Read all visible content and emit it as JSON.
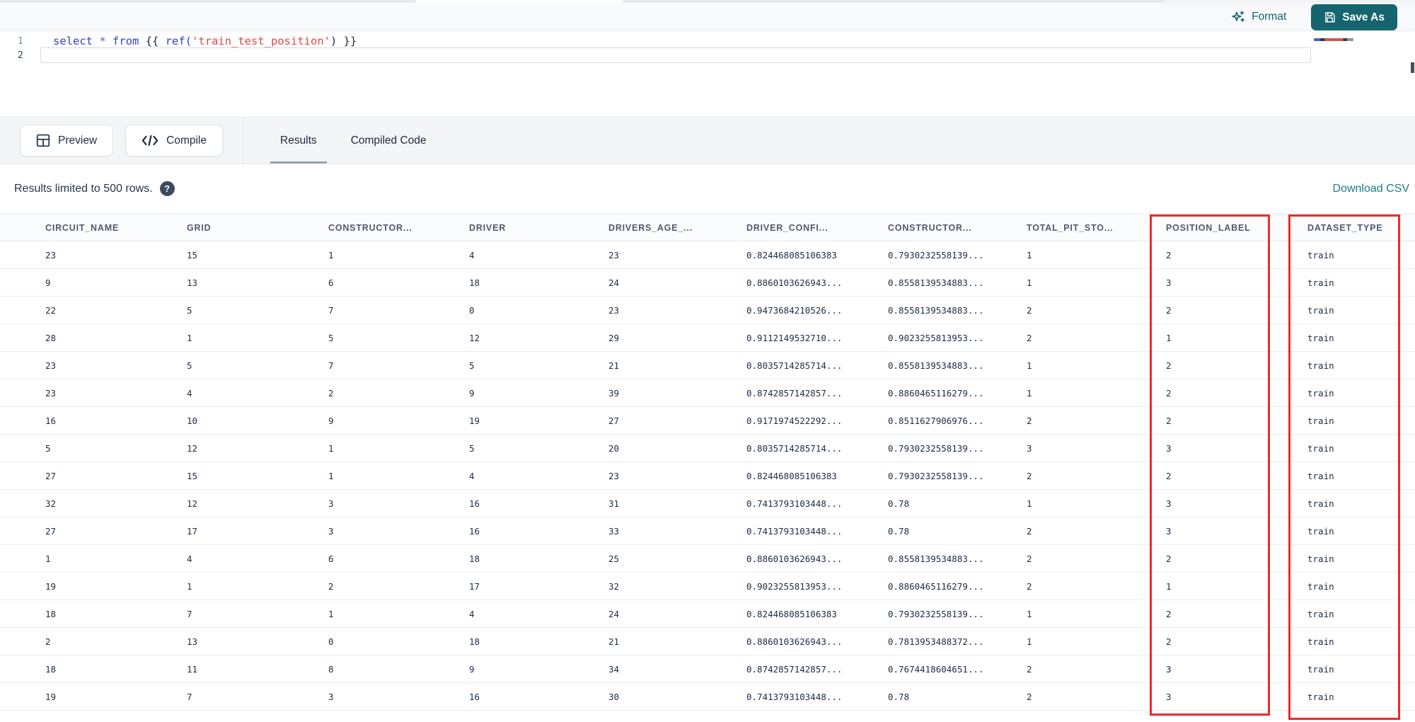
{
  "colors": {
    "accent_teal": "#14656E",
    "link_teal": "#1B7D89",
    "annotation_red": "#F1282C"
  },
  "editor_toolbar": {
    "format_label": "Format",
    "save_as_label": "Save As"
  },
  "editor": {
    "line_numbers": [
      "1",
      "2"
    ],
    "code_tokens": [
      {
        "t": "select",
        "c": "kw"
      },
      {
        "t": " ",
        "c": "pl"
      },
      {
        "t": "*",
        "c": "op"
      },
      {
        "t": " ",
        "c": "pl"
      },
      {
        "t": "from",
        "c": "kw"
      },
      {
        "t": " ",
        "c": "pl"
      },
      {
        "t": "{{ ",
        "c": "br"
      },
      {
        "t": "ref(",
        "c": "fn"
      },
      {
        "t": "'train_test_position'",
        "c": "str"
      },
      {
        "t": ")",
        "c": "br"
      },
      {
        "t": " }}",
        "c": "br"
      }
    ]
  },
  "action_bar": {
    "preview_label": "Preview",
    "compile_label": "Compile",
    "tabs": [
      {
        "label": "Results",
        "active": true
      },
      {
        "label": "Compiled Code",
        "active": false
      }
    ]
  },
  "results_bar": {
    "limit_text": "Results limited to 500 rows.",
    "help_glyph": "?",
    "download_label": "Download CSV"
  },
  "table": {
    "columns": [
      "CIRCUIT_NAME",
      "GRID",
      "CONSTRUCTOR...",
      "DRIVER",
      "DRIVERS_AGE_...",
      "DRIVER_CONFI...",
      "CONSTRUCTOR...",
      "TOTAL_PIT_STO...",
      "POSITION_LABEL",
      "DATASET_TYPE"
    ],
    "highlighted_columns": [
      "POSITION_LABEL",
      "DATASET_TYPE"
    ],
    "rows": [
      [
        "23",
        "15",
        "1",
        "4",
        "23",
        "0.824468085106383",
        "0.7930232558139...",
        "1",
        "2",
        "train"
      ],
      [
        "9",
        "13",
        "6",
        "18",
        "24",
        "0.8860103626943...",
        "0.8558139534883...",
        "1",
        "3",
        "train"
      ],
      [
        "22",
        "5",
        "7",
        "0",
        "23",
        "0.9473684210526...",
        "0.8558139534883...",
        "2",
        "2",
        "train"
      ],
      [
        "28",
        "1",
        "5",
        "12",
        "29",
        "0.9112149532710...",
        "0.9023255813953...",
        "2",
        "1",
        "train"
      ],
      [
        "23",
        "5",
        "7",
        "5",
        "21",
        "0.8035714285714...",
        "0.8558139534883...",
        "1",
        "2",
        "train"
      ],
      [
        "23",
        "4",
        "2",
        "9",
        "39",
        "0.8742857142857...",
        "0.8860465116279...",
        "1",
        "2",
        "train"
      ],
      [
        "16",
        "10",
        "9",
        "19",
        "27",
        "0.9171974522292...",
        "0.8511627906976...",
        "2",
        "2",
        "train"
      ],
      [
        "5",
        "12",
        "1",
        "5",
        "20",
        "0.8035714285714...",
        "0.7930232558139...",
        "3",
        "3",
        "train"
      ],
      [
        "27",
        "15",
        "1",
        "4",
        "23",
        "0.824468085106383",
        "0.7930232558139...",
        "2",
        "2",
        "train"
      ],
      [
        "32",
        "12",
        "3",
        "16",
        "31",
        "0.7413793103448...",
        "0.78",
        "1",
        "3",
        "train"
      ],
      [
        "27",
        "17",
        "3",
        "16",
        "33",
        "0.7413793103448...",
        "0.78",
        "2",
        "3",
        "train"
      ],
      [
        "1",
        "4",
        "6",
        "18",
        "25",
        "0.8860103626943...",
        "0.8558139534883...",
        "2",
        "2",
        "train"
      ],
      [
        "19",
        "1",
        "2",
        "17",
        "32",
        "0.9023255813953...",
        "0.8860465116279...",
        "2",
        "1",
        "train"
      ],
      [
        "18",
        "7",
        "1",
        "4",
        "24",
        "0.824468085106383",
        "0.7930232558139...",
        "1",
        "2",
        "train"
      ],
      [
        "2",
        "13",
        "0",
        "18",
        "21",
        "0.8860103626943...",
        "0.7813953488372...",
        "1",
        "2",
        "train"
      ],
      [
        "18",
        "11",
        "8",
        "9",
        "34",
        "0.8742857142857...",
        "0.7674418604651...",
        "2",
        "3",
        "train"
      ],
      [
        "19",
        "7",
        "3",
        "16",
        "30",
        "0.7413793103448...",
        "0.78",
        "2",
        "3",
        "train"
      ]
    ]
  }
}
